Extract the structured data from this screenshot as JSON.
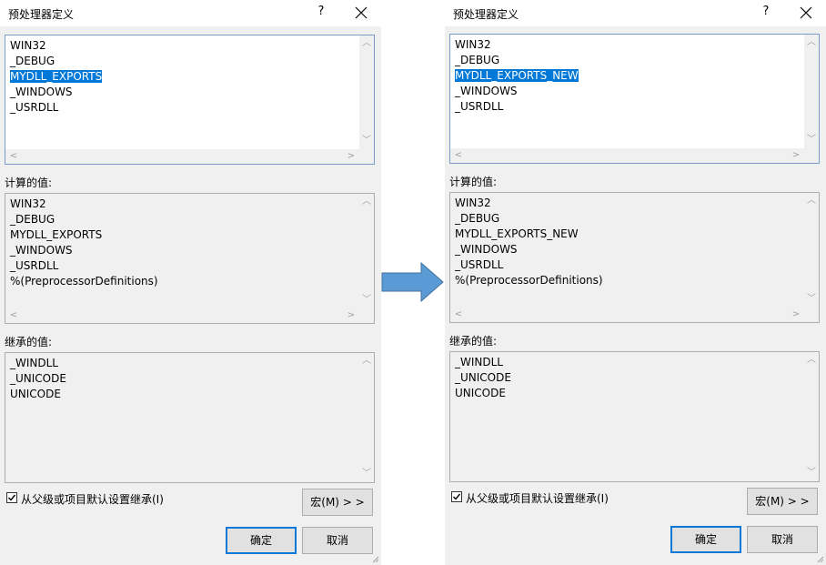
{
  "left": {
    "title": "预处理器定义",
    "help": "?",
    "definitions": [
      "WIN32",
      "_DEBUG",
      "MYDLL_EXPORTS",
      "_WINDOWS",
      "_USRDLL"
    ],
    "computed_label": "计算的值:",
    "computed": [
      "WIN32",
      "_DEBUG",
      "MYDLL_EXPORTS",
      "_WINDOWS",
      "_USRDLL",
      "%(PreprocessorDefinitions)"
    ],
    "inherited_label": "继承的值:",
    "inherited": [
      "_WINDLL",
      "_UNICODE",
      "UNICODE"
    ],
    "inherit_checkbox_label": "从父级或项目默认设置继承(I)",
    "macro_button": "宏(M) > >",
    "ok_button": "确定",
    "cancel_button": "取消"
  },
  "right": {
    "title": "预处理器定义",
    "help": "?",
    "definitions": [
      "WIN32",
      "_DEBUG",
      "MYDLL_EXPORTS_NEW",
      "_WINDOWS",
      "_USRDLL"
    ],
    "computed_label": "计算的值:",
    "computed": [
      "WIN32",
      "_DEBUG",
      "MYDLL_EXPORTS_NEW",
      "_WINDOWS",
      "_USRDLL",
      "%(PreprocessorDefinitions)"
    ],
    "inherited_label": "继承的值:",
    "inherited": [
      "_WINDLL",
      "_UNICODE",
      "UNICODE"
    ],
    "inherit_checkbox_label": "从父级或项目默认设置继承(I)",
    "macro_button": "宏(M) > >",
    "ok_button": "确定",
    "cancel_button": "取消"
  },
  "colors": {
    "selection": "#0078d7",
    "arrow": "#5b9bd5",
    "dialog_bg": "#f0f0f0"
  }
}
